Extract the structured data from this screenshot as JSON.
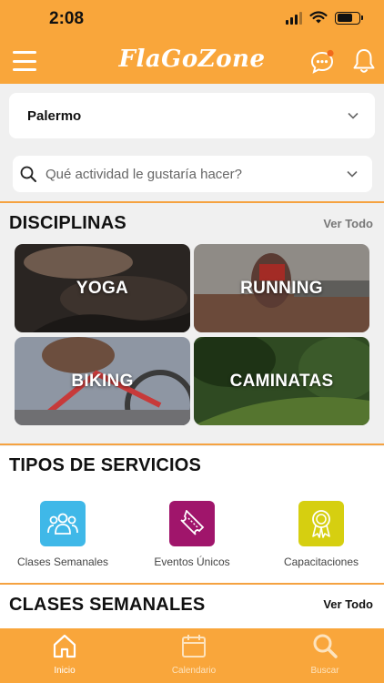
{
  "status_bar": {
    "time": "2:08"
  },
  "app": {
    "title": "FlaGoZone"
  },
  "location": {
    "selected": "Palermo"
  },
  "search": {
    "placeholder": "Qué actividad le gustaría hacer?"
  },
  "disciplinas": {
    "title": "DISCIPLINAS",
    "see_all": "Ver Todo",
    "items": [
      {
        "label": "YOGA"
      },
      {
        "label": "RUNNING"
      },
      {
        "label": "BIKING"
      },
      {
        "label": "CAMINATAS"
      }
    ]
  },
  "servicios": {
    "title": "TIPOS DE SERVICIOS",
    "items": [
      {
        "label": "Clases Semanales",
        "icon": "group-icon",
        "color": "#3fb8e8"
      },
      {
        "label": "Eventos Únicos",
        "icon": "ticket-icon",
        "color": "#a0156b"
      },
      {
        "label": "Capacitaciones",
        "icon": "award-icon",
        "color": "#d6cf10"
      }
    ]
  },
  "clases": {
    "title": "CLASES SEMANALES",
    "see_all": "Ver Todo"
  },
  "tabbar": {
    "items": [
      {
        "label": "Inicio",
        "icon": "home-icon",
        "active": true
      },
      {
        "label": "Calendario",
        "icon": "calendar-icon",
        "active": false
      },
      {
        "label": "Buscar",
        "icon": "search-icon",
        "active": false
      }
    ]
  },
  "colors": {
    "brand": "#f9a63b",
    "tab_active": "#ffffff",
    "tab_inactive": "#fde3bd"
  }
}
